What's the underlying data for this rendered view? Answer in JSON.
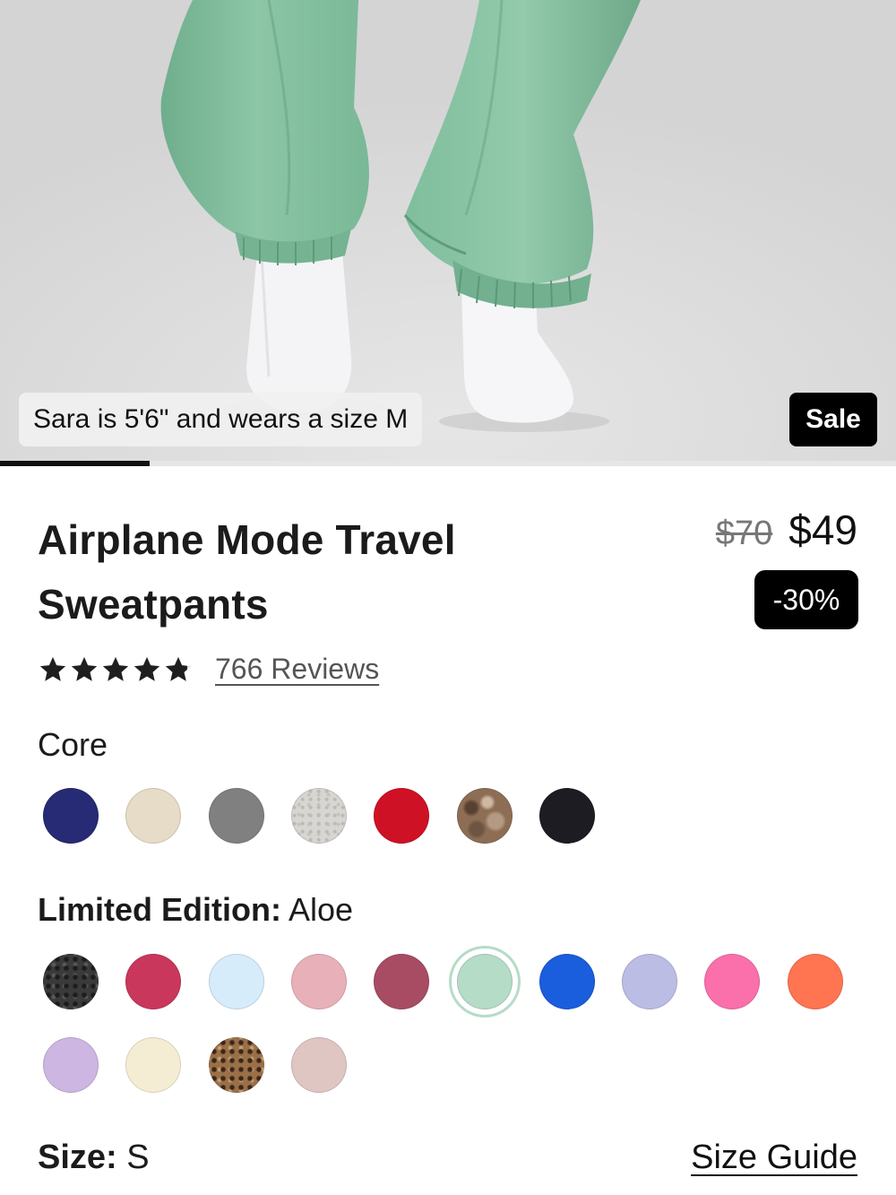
{
  "hero": {
    "model_caption": "Sara is 5'6\" and wears a size M",
    "badge": "Sale",
    "carousel_progress": 0.167
  },
  "product": {
    "title_line1": "Airplane Mode Travel",
    "title_line2": "Sweatpants",
    "old_price": "$70",
    "new_price": "$49",
    "discount": "-30%",
    "rating": 4.8,
    "reviews_text": "766 Reviews"
  },
  "colors": {
    "core_label": "Core",
    "core": [
      {
        "name": "navy",
        "color": "#272a74"
      },
      {
        "name": "cream",
        "color": "#e6dcc7"
      },
      {
        "name": "grey",
        "color": "#808080"
      },
      {
        "name": "heather-grey",
        "color": "#d8d6d2",
        "pattern": "speckle"
      },
      {
        "name": "red",
        "color": "#cf1125"
      },
      {
        "name": "camo-brown",
        "color": "#8d6e55",
        "pattern": "camo"
      },
      {
        "name": "black",
        "color": "#1c1c22"
      }
    ],
    "limited_label": "Limited Edition:",
    "limited_selected": "Aloe",
    "limited": [
      {
        "name": "black-leopard",
        "color": "#3a3a3a",
        "pattern": "leopard-dark"
      },
      {
        "name": "raspberry",
        "color": "#c9375d"
      },
      {
        "name": "sky",
        "color": "#d6ecfb"
      },
      {
        "name": "pink",
        "color": "#e8b1b9"
      },
      {
        "name": "wine",
        "color": "#a84c63"
      },
      {
        "name": "aloe",
        "color": "#b5dcc7",
        "selected": true
      },
      {
        "name": "cobalt",
        "color": "#1a5ddd"
      },
      {
        "name": "periwinkle",
        "color": "#bbbde4"
      },
      {
        "name": "hot-pink",
        "color": "#fb6fab"
      },
      {
        "name": "orange",
        "color": "#ff7451"
      },
      {
        "name": "lilac",
        "color": "#cdb7e2"
      },
      {
        "name": "ivory",
        "color": "#f5edd3"
      },
      {
        "name": "leopard",
        "color": "#9a7048",
        "pattern": "leopard"
      },
      {
        "name": "blush",
        "color": "#dfc6c3"
      }
    ]
  },
  "size": {
    "label": "Size:",
    "value": "S",
    "guide": "Size Guide"
  }
}
